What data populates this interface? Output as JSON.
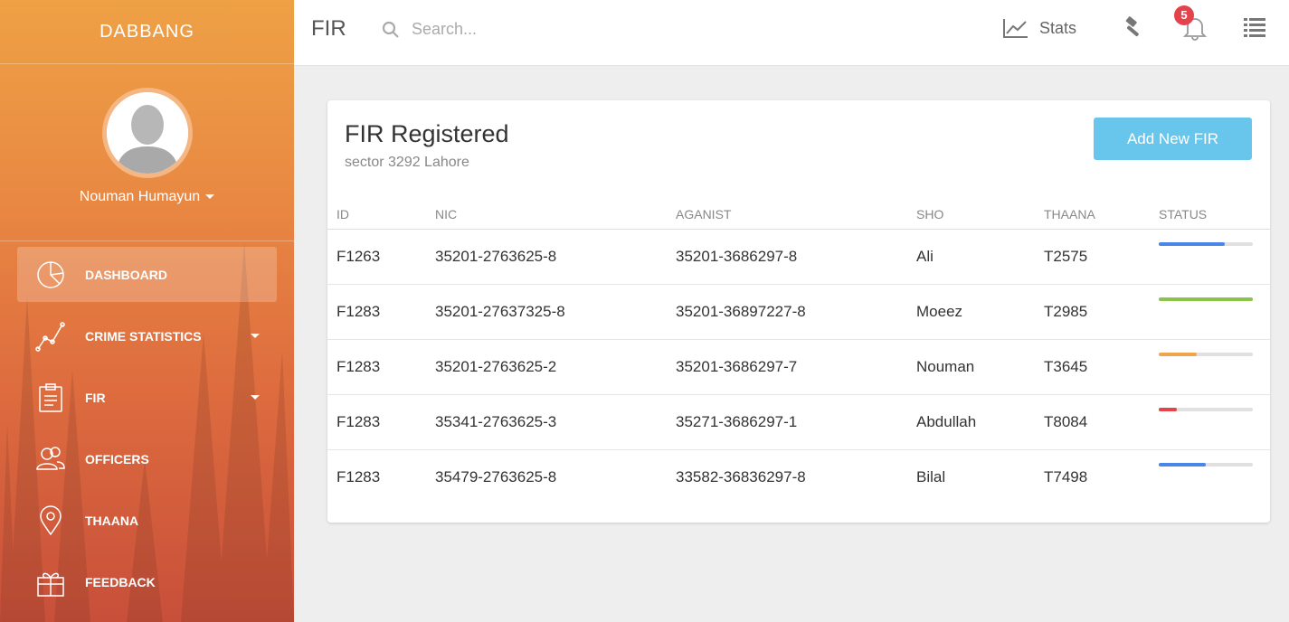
{
  "sidebar": {
    "brand": "DABBANG",
    "user_name": "Nouman Humayun",
    "items": [
      {
        "label": "DASHBOARD",
        "icon": "pie-chart-icon",
        "active": true,
        "has_caret": false
      },
      {
        "label": "CRIME STATISTICS",
        "icon": "line-chart-icon",
        "active": false,
        "has_caret": true
      },
      {
        "label": "FIR",
        "icon": "clipboard-icon",
        "active": false,
        "has_caret": true
      },
      {
        "label": "OFFICERS",
        "icon": "users-icon",
        "active": false,
        "has_caret": false
      },
      {
        "label": "THAANA",
        "icon": "map-pin-icon",
        "active": false,
        "has_caret": false
      },
      {
        "label": "FEEDBACK",
        "icon": "gift-icon",
        "active": false,
        "has_caret": false
      }
    ]
  },
  "topbar": {
    "title": "FIR",
    "search_placeholder": "Search...",
    "stats_label": "Stats",
    "notification_count": "5"
  },
  "card": {
    "title": "FIR Registered",
    "subtitle": "sector 3292 Lahore",
    "add_button": "Add New FIR",
    "columns": [
      "ID",
      "NIC",
      "AGANIST",
      "SHO",
      "THAANA",
      "STATUS"
    ],
    "rows": [
      {
        "id": "F1263",
        "nic": "35201-2763625-8",
        "against": "35201-3686297-8",
        "sho": "Ali",
        "thaana": "T2575",
        "status": 0.7,
        "status_color": "#4a86e8"
      },
      {
        "id": "F1283",
        "nic": "35201-27637325-8",
        "against": "35201-36897227-8",
        "sho": "Moeez",
        "thaana": "T2985",
        "status": 1.0,
        "status_color": "#8bc34a"
      },
      {
        "id": "F1283",
        "nic": "35201-2763625-2",
        "against": "35201-3686297-7",
        "sho": "Nouman",
        "thaana": "T3645",
        "status": 0.4,
        "status_color": "#f0a44b"
      },
      {
        "id": "F1283",
        "nic": "35341-2763625-3",
        "against": "35271-3686297-1",
        "sho": "Abdullah",
        "thaana": "T8084",
        "status": 0.19,
        "status_color": "#e5434c"
      },
      {
        "id": "F1283",
        "nic": "35479-2763625-8",
        "against": "33582-36836297-8",
        "sho": "Bilal",
        "thaana": "T7498",
        "status": 0.5,
        "status_color": "#4a86e8"
      }
    ]
  }
}
